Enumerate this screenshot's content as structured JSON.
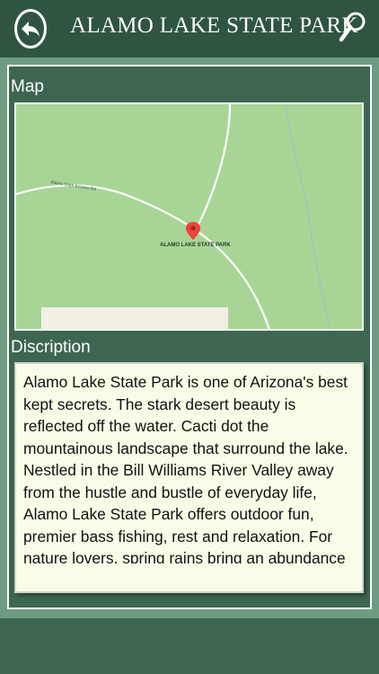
{
  "header": {
    "title": "ALAMO LAKE STATE PARK",
    "back_icon": "back-arrow-icon",
    "search_icon": "search-icon"
  },
  "map_section": {
    "label": "Map",
    "place_label": "ALAMO LAKE STATE PARK",
    "road_label": "Alamo Dam Access Rd",
    "marker_icon": "map-pin-icon"
  },
  "description_section": {
    "label": "Discription",
    "text": "Alamo Lake State Park is one of Arizona's best kept secrets. The stark desert beauty is reflected off the water. Cacti dot the mountainous landscape that surround the lake. Nestled in the Bill Williams River Valley away from the hustle and bustle of everyday life, Alamo Lake State Park offers outdoor fun, premier bass fishing, rest and relaxation. For nature lovers, spring rains bring an abundance of wild flowers and the lake environment attracts a variety"
  },
  "colors": {
    "header_bg": "#2f5541",
    "panel_bg": "#3d6650",
    "page_bg": "#6f9b81",
    "map_green": "#a8d596",
    "description_bg": "#fbfce7",
    "marker_red": "#e8453c"
  }
}
